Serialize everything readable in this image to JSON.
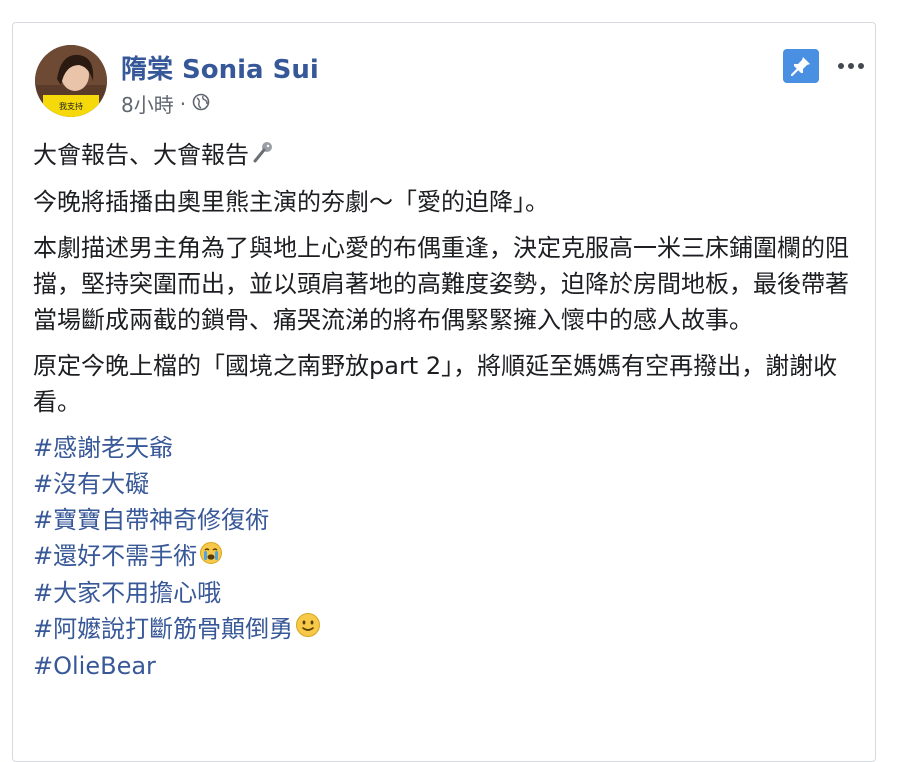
{
  "post": {
    "author": "隋棠 Sonia Sui",
    "time": "8小時",
    "separator": "·",
    "avatar_caption": "我支持",
    "paragraphs": [
      "大會報告、大會報告",
      "今晚將插播由奧里熊主演的夯劇～「愛的迫降」。",
      "本劇描述男主角為了與地上心愛的布偶重逢，決定克服高一米三床鋪圍欄的阻擋，堅持突圍而出，並以頭肩著地的高難度姿勢，迫降於房間地板，最後帶著當場斷成兩截的鎖骨、痛哭流涕的將布偶緊緊擁入懷中的感人故事。",
      "原定今晚上檔的「國境之南野放part 2」，將順延至媽媽有空再撥出，謝謝收看。"
    ],
    "hashtags": [
      "#感謝老天爺",
      "#沒有大礙",
      "#寶寶自帶神奇修復術",
      "#還好不需手術",
      "#大家不用擔心哦",
      "#阿嬤說打斷筋骨顛倒勇",
      "#OlieBear"
    ],
    "icons": {
      "privacy": "globe-icon",
      "pin": "pin-icon",
      "more": "more-options-icon",
      "paragraph1": "microphone-emoji",
      "hashtag4": "crying-face-emoji",
      "hashtag6": "slightly-smiling-face-emoji"
    },
    "colors": {
      "name": "#365899",
      "hashtag": "#385898",
      "pin_bg": "#4a90e2",
      "text": "#1c1e21",
      "meta": "#606770"
    }
  }
}
